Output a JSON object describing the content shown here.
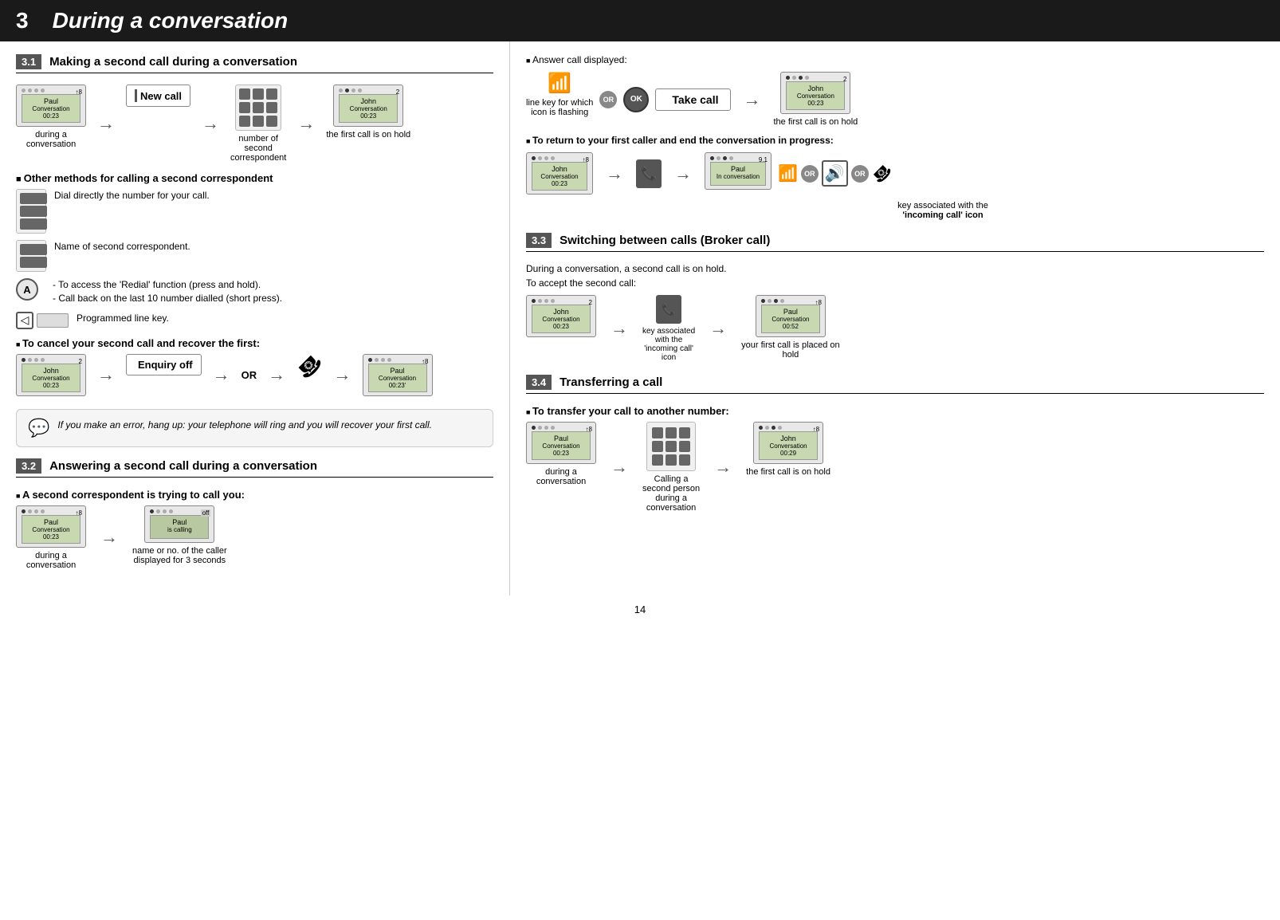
{
  "header": {
    "section_num": "3",
    "section_title": "During a conversation"
  },
  "section31": {
    "num": "3.1",
    "title": "Making a second call during a conversation",
    "flow": {
      "item1_line1": "Paul",
      "item1_line2": "Conversation 00:23",
      "item1_label1": "during a",
      "item1_label2": "conversation",
      "btn_new_call": "New call",
      "item2_label1": "number of",
      "item2_label2": "second",
      "item2_label3": "correspondent",
      "item3_line1": "John",
      "item3_line2": "Conversation 00:23",
      "item3_label": "the first call is on hold"
    },
    "other_methods_header": "Other methods for calling a second correspondent",
    "methods": [
      {
        "text": "Dial directly the number for your call."
      },
      {
        "text": "Name of second correspondent."
      },
      {
        "text": "- To access the 'Redial' function (press and hold).\n- Call back on the last 10 number dialled (short press)."
      },
      {
        "text": "Programmed line key."
      }
    ],
    "cancel_header": "To cancel your second call and recover the first:",
    "cancel_flow": {
      "item1_line1": "John",
      "item1_line2": "Conversation 00:23",
      "btn_enquiry_off": "Enquiry off",
      "item2_line1": "Paul",
      "item2_line2": "Conversation 00:23'"
    }
  },
  "note": {
    "text": "If you make an error, hang up: your telephone will ring and you will recover your first call."
  },
  "section32": {
    "num": "3.2",
    "title": "Answering a second call during a conversation",
    "sub_header": "A second correspondent is trying to call you:",
    "flow": {
      "item1_line1": "Paul",
      "item1_line2": "Conversation 00:23",
      "item1_label1": "during a",
      "item1_label2": "conversation",
      "item2_line1": "Paul",
      "item2_line2": "is calling",
      "item2_label1": "name or no. of the caller",
      "item2_label2": "displayed for 3 seconds"
    }
  },
  "section32_right": {
    "answer_header": "Answer call displayed:",
    "take_call_btn": "Take call",
    "item1_label": "line key for which\nicon is flashing",
    "item2_label": "the first call is on hold",
    "item2_line1": "John",
    "item2_line2": "Conversation 00:23",
    "return_header": "To return to your first caller and end the conversation in progress:",
    "return_flow": {
      "item1_line1": "John",
      "item1_line2": "Conversation 00:23",
      "item2_line1": "Paul",
      "item2_line2": "In conversation"
    },
    "key_label": "key associated with the\n'incoming call' icon"
  },
  "section33": {
    "num": "3.3",
    "title": "Switching between calls (Broker call)",
    "intro1": "During a conversation, a second call is on hold.",
    "intro2": "To accept the second call:",
    "flow": {
      "item1_line1": "John",
      "item1_line2": "Conversation 00:23",
      "key_label": "key associated\nwith the\n'incoming call'\nicon",
      "item2_line1": "Paul",
      "item2_line2": "Conversation 00:52",
      "item2_label": "your first call is placed on\nhold"
    }
  },
  "section34": {
    "num": "3.4",
    "title": "Transferring a call",
    "sub_header": "To transfer your call to another number:",
    "flow": {
      "item1_line1": "Paul",
      "item1_line2": "Conversation 00:23",
      "item1_label1": "during a",
      "item1_label2": "conversation",
      "calling_label1": "Calling a",
      "calling_label2": "second person",
      "calling_label3": "during a",
      "calling_label4": "conversation",
      "item2_line1": "John",
      "item2_line2": "Conversation 00:29",
      "item2_label": "the first call is on hold"
    }
  },
  "page_num": "14"
}
